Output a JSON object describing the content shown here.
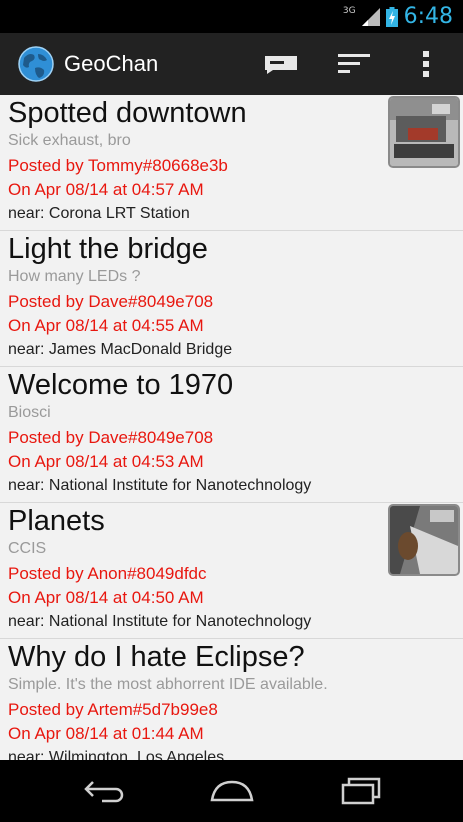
{
  "status_bar": {
    "network": "3G",
    "time": "6:48"
  },
  "action_bar": {
    "app_title": "GeoChan"
  },
  "posts": [
    {
      "title": "Spotted downtown",
      "subtitle": "Sick exhaust, bro",
      "posted_by": "Posted by Tommy#80668e3b",
      "date": "On Apr 08/14 at 04:57 AM",
      "near": "near: Corona LRT Station",
      "has_image": true
    },
    {
      "title": "Light the bridge",
      "subtitle": "How many LEDs ?",
      "posted_by": "Posted by Dave#8049e708",
      "date": "On Apr 08/14 at 04:55 AM",
      "near": "near: James MacDonald Bridge",
      "has_image": false
    },
    {
      "title": "Welcome to 1970",
      "subtitle": "Biosci",
      "posted_by": "Posted by Dave#8049e708",
      "date": "On Apr 08/14 at 04:53 AM",
      "near": "near: National Institute for Nanotechnology",
      "has_image": false
    },
    {
      "title": "Planets",
      "subtitle": "CCIS",
      "posted_by": "Posted by Anon#8049dfdc",
      "date": "On Apr 08/14 at 04:50 AM",
      "near": "near: National Institute for Nanotechnology",
      "has_image": true
    },
    {
      "title": "Why do I hate Eclipse?",
      "subtitle": "Simple. It's the most abhorrent IDE available.",
      "posted_by": "Posted by Artem#5d7b99e8",
      "date": "On Apr 08/14 at 01:44 AM",
      "near": "near: Wilmington, Los Angeles",
      "has_image": false
    }
  ],
  "colors": {
    "accent_time": "#33b5e5",
    "post_meta_red": "#e8170f",
    "action_bar_bg": "#222222"
  }
}
